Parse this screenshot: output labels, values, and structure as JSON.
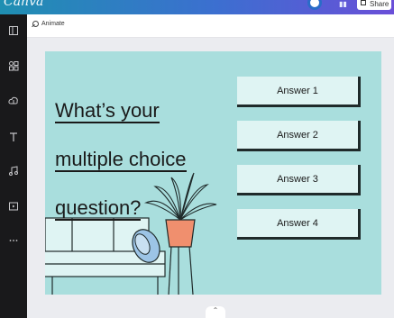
{
  "app": {
    "logo_text": "Canva",
    "share_label": "Share"
  },
  "toolbar": {
    "animate_label": "Animate"
  },
  "sidebar": {
    "items": [
      {
        "icon": "templates-icon"
      },
      {
        "icon": "elements-icon"
      },
      {
        "icon": "uploads-icon"
      },
      {
        "icon": "text-icon"
      },
      {
        "icon": "audio-icon"
      },
      {
        "icon": "videos-icon"
      },
      {
        "icon": "more-icon"
      }
    ]
  },
  "slide": {
    "question_lines": [
      "What’s your",
      "multiple choice",
      "question?"
    ],
    "answers": [
      "Answer 1",
      "Answer 2",
      "Answer 3",
      "Answer 4"
    ],
    "background_color": "#a9dedd",
    "answer_fill": "#dff4f3"
  },
  "colors": {
    "sidebar": "#19191b",
    "topbar_start": "#1f8fb2",
    "topbar_end": "#6a4fd8"
  }
}
